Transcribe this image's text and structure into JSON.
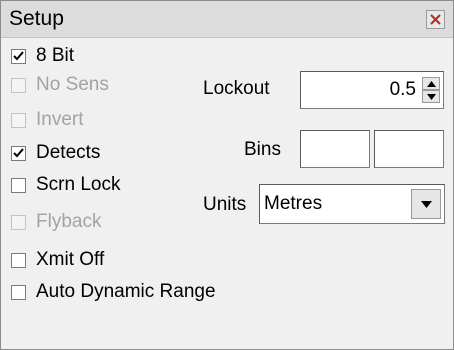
{
  "window": {
    "title": "Setup",
    "accent": "#dcdcdc"
  },
  "checkboxes": [
    {
      "label": "8 Bit",
      "checked": true,
      "disabled": false
    },
    {
      "label": "No Sens",
      "checked": false,
      "disabled": true
    },
    {
      "label": "Invert",
      "checked": false,
      "disabled": true
    },
    {
      "label": "Detects",
      "checked": true,
      "disabled": false
    },
    {
      "label": "Scrn Lock",
      "checked": false,
      "disabled": false
    },
    {
      "label": "Flyback",
      "checked": false,
      "disabled": true
    },
    {
      "label": "Xmit Off",
      "checked": false,
      "disabled": false
    },
    {
      "label": "Auto Dynamic Range",
      "checked": false,
      "disabled": false
    }
  ],
  "lockout": {
    "label": "Lockout",
    "value": "0.5"
  },
  "bins": {
    "label": "Bins",
    "value1": "",
    "value2": ""
  },
  "units": {
    "label": "Units",
    "selected": "Metres"
  },
  "icons": {
    "close": "close-icon",
    "spin_up": "arrow-up-icon",
    "spin_down": "arrow-down-icon",
    "dropdown": "chevron-down-icon"
  }
}
